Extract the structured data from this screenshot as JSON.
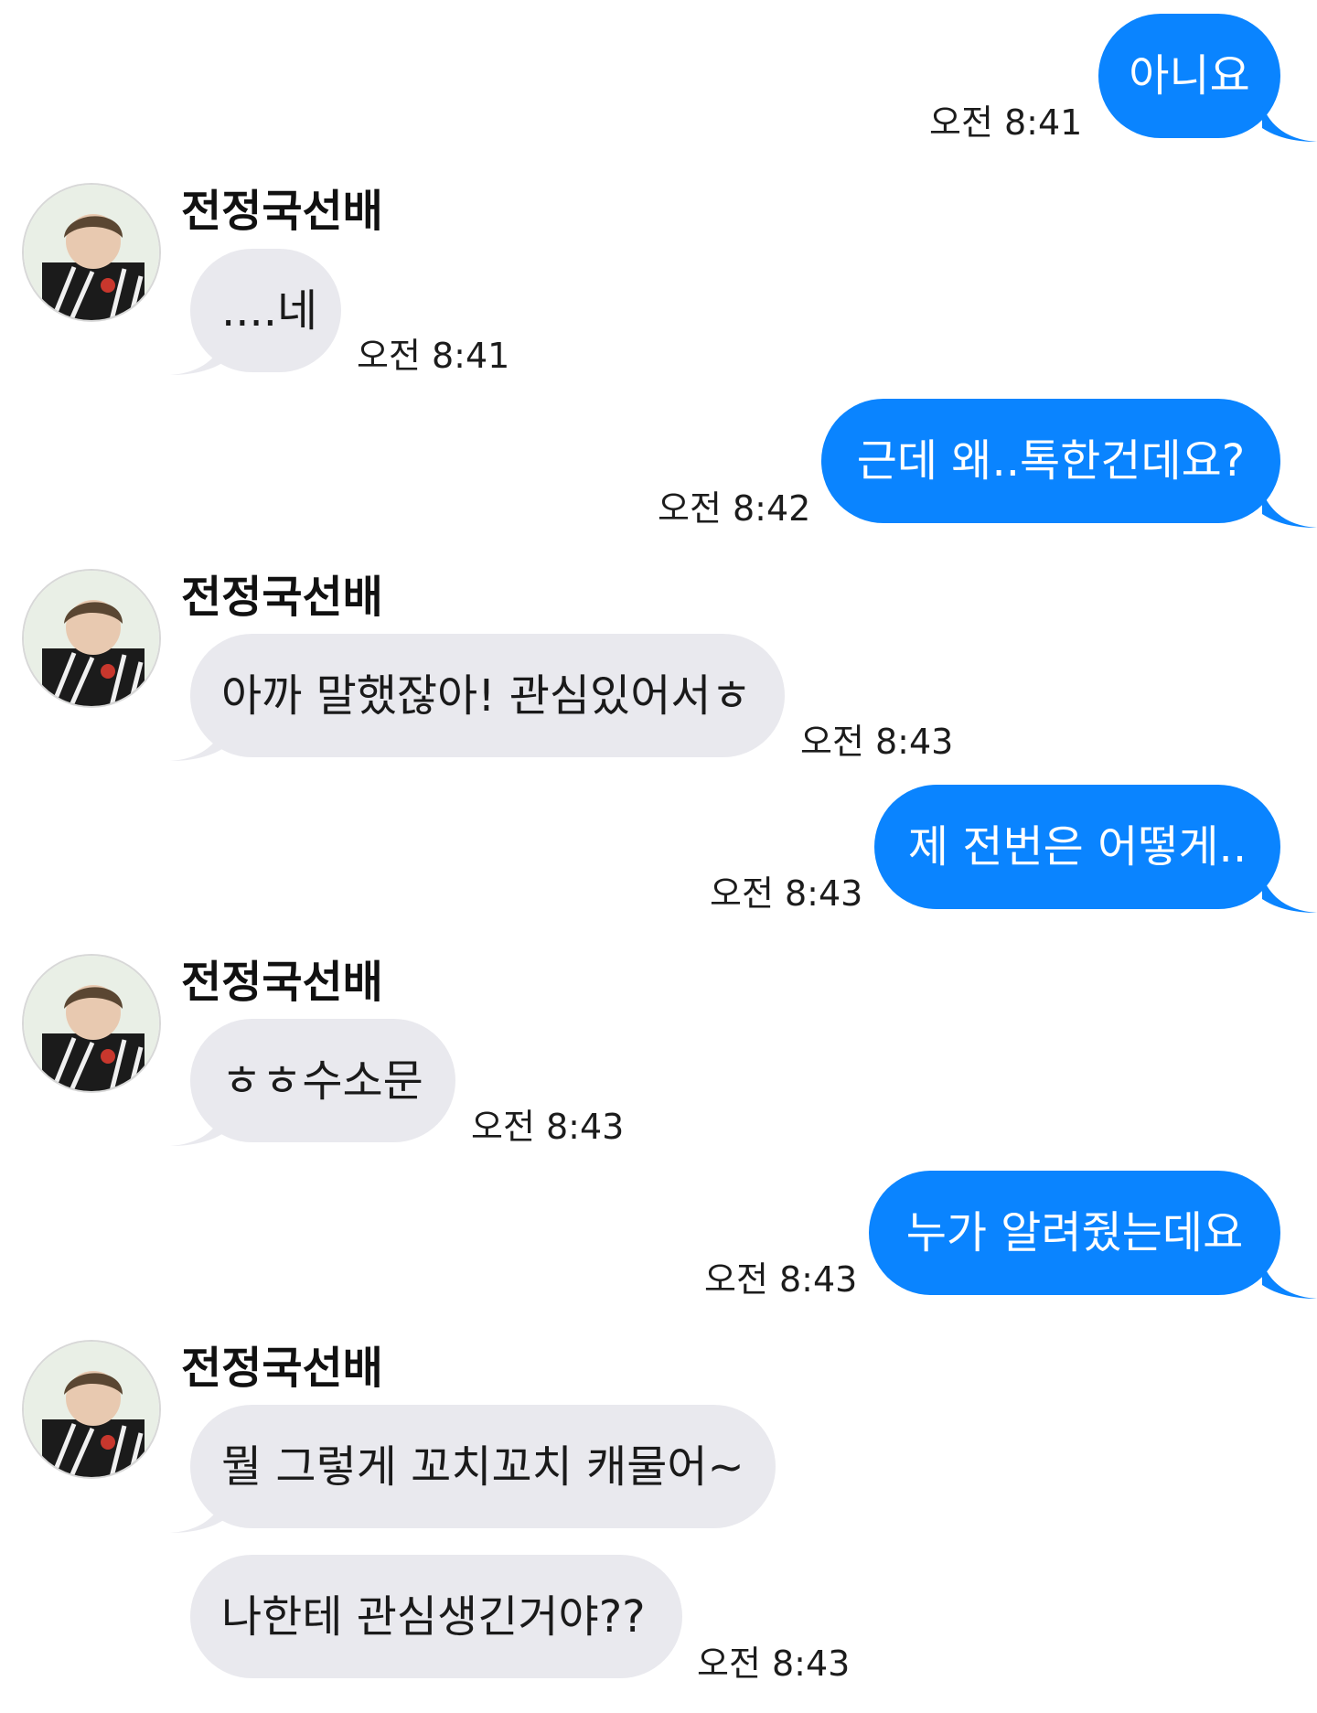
{
  "conversation": {
    "contact_name": "전정국선배",
    "avatar_icon": "profile-photo-avatar",
    "colors": {
      "outgoing_bubble": "#0a84ff",
      "incoming_bubble": "#e9e9ee"
    },
    "messages": [
      {
        "direction": "out",
        "text": "아니요",
        "time": "오전 8:41"
      },
      {
        "direction": "in",
        "sender": "전정국선배",
        "text": "....네",
        "time": "오전 8:41"
      },
      {
        "direction": "out",
        "text": "근데 왜..톡한건데요?",
        "time": "오전 8:42"
      },
      {
        "direction": "in",
        "sender": "전정국선배",
        "text": "아까 말했잖아! 관심있어서ㅎ",
        "time": "오전 8:43"
      },
      {
        "direction": "out",
        "text": "제 전번은 어떻게..",
        "time": "오전 8:43"
      },
      {
        "direction": "in",
        "sender": "전정국선배",
        "text": "ㅎㅎ수소문",
        "time": "오전 8:43"
      },
      {
        "direction": "out",
        "text": "누가 알려줬는데요",
        "time": "오전 8:43"
      },
      {
        "direction": "in",
        "sender": "전정국선배",
        "text": "뭘 그렇게 꼬치꼬치 캐물어~",
        "time": ""
      },
      {
        "direction": "in",
        "text": "나한테 관심생긴거야??",
        "time": "오전 8:43"
      }
    ]
  }
}
